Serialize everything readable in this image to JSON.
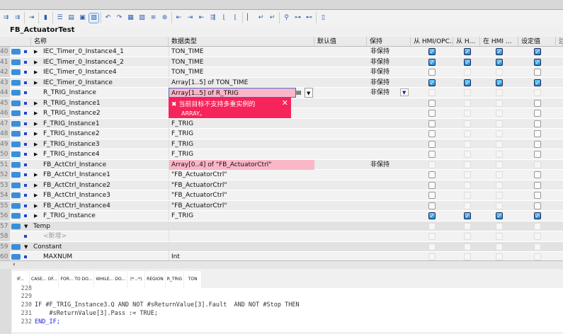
{
  "block_title": "FB_ActuatorTest",
  "headers": [
    "名称",
    "数据类型",
    "默认值",
    "保持",
    "从 HMI/OPC...",
    "从 H...",
    "在 HMI ...",
    "设定值",
    "注"
  ],
  "rows": [
    {
      "n": "40",
      "name": "IEC_Timer_0_Instance4_1",
      "type": "TON_TIME",
      "retain": "非保持",
      "exp": true,
      "cb": "on"
    },
    {
      "n": "41",
      "name": "IEC_Timer_0_Instance4_2",
      "type": "TON_TIME",
      "retain": "非保持",
      "exp": true,
      "cb": "on"
    },
    {
      "n": "42",
      "name": "IEC_Timer_0_Instance4",
      "type": "TON_TIME",
      "retain": "非保持",
      "exp": true,
      "cb": "part"
    },
    {
      "n": "43",
      "name": "IEC_Timer_0_Instance",
      "type": "Array[1..5] of TON_TIME",
      "retain": "非保持",
      "exp": true,
      "cb": "on"
    },
    {
      "n": "44",
      "name": "R_TRIG_Instance",
      "type": "Array[1..5] of R_TRIG",
      "retain": "非保持",
      "exp": false,
      "cb": "dis",
      "error": true,
      "editing": true
    },
    {
      "n": "45",
      "name": "R_TRIG_Instance1",
      "type": "",
      "retain": "",
      "exp": true,
      "cb": "part"
    },
    {
      "n": "46",
      "name": "R_TRIG_Instance2",
      "type": "",
      "retain": "",
      "exp": true,
      "cb": "part"
    },
    {
      "n": "47",
      "name": "F_TRIG_Instance1",
      "type": "F_TRIG",
      "retain": "",
      "exp": true,
      "cb": "part"
    },
    {
      "n": "48",
      "name": "F_TRIG_Instance2",
      "type": "F_TRIG",
      "retain": "",
      "exp": true,
      "cb": "part"
    },
    {
      "n": "49",
      "name": "F_TRIG_Instance3",
      "type": "F_TRIG",
      "retain": "",
      "exp": true,
      "cb": "part"
    },
    {
      "n": "50",
      "name": "F_TRIG_Instance4",
      "type": "F_TRIG",
      "retain": "",
      "exp": true,
      "cb": "part"
    },
    {
      "n": "51",
      "name": "FB_ActCtrl_Instance",
      "type": "Array[0..4] of \"FB_ActuatorCtrl\"",
      "retain": "非保持",
      "exp": false,
      "cb": "dis",
      "error": true
    },
    {
      "n": "52",
      "name": "FB_ActCtrl_Instance1",
      "type": "\"FB_ActuatorCtrl\"",
      "retain": "",
      "exp": true,
      "cb": "part"
    },
    {
      "n": "53",
      "name": "FB_ActCtrl_Instance2",
      "type": "\"FB_ActuatorCtrl\"",
      "retain": "",
      "exp": true,
      "cb": "part"
    },
    {
      "n": "54",
      "name": "FB_ActCtrl_Instance3",
      "type": "\"FB_ActuatorCtrl\"",
      "retain": "",
      "exp": true,
      "cb": "part"
    },
    {
      "n": "55",
      "name": "FB_ActCtrl_Instance4",
      "type": "\"FB_ActuatorCtrl\"",
      "retain": "",
      "exp": true,
      "cb": "part"
    },
    {
      "n": "56",
      "name": "F_TRIG_Instance",
      "type": "F_TRIG",
      "retain": "",
      "exp": true,
      "cb": "on"
    },
    {
      "n": "57",
      "name": "Temp",
      "type": "",
      "retain": "",
      "section": true,
      "cb": "dis"
    },
    {
      "n": "58",
      "name": "<新增>",
      "type": "",
      "retain": "",
      "add": true,
      "cb": "dis"
    },
    {
      "n": "59",
      "name": "Constant",
      "type": "",
      "retain": "",
      "section": true,
      "cb": "dis"
    },
    {
      "n": "60",
      "name": "MAXNUM",
      "type": "Int",
      "retain": "",
      "cb": "dis"
    }
  ],
  "error_message": {
    "line1": "当前目标不支持多重实例的",
    "line2": "ARRAY。"
  },
  "snippets": [
    "IF...",
    "CASE... OF...",
    "FOR... TO DO...",
    "WHILE... DO...",
    "(*...*)",
    "REGION",
    "R_TRIG",
    "TON"
  ],
  "code": [
    {
      "n": "229",
      "text": ""
    },
    {
      "n": "230",
      "text": "IF #F_TRIG_Instance3.Q AND NOT #sReturnValue[3].Fault  AND NOT #Stop THEN"
    },
    {
      "n": "231",
      "text": "    #sReturnValue[3].Pass := TRUE;"
    },
    {
      "n": "232",
      "text": "END_IF;"
    }
  ]
}
